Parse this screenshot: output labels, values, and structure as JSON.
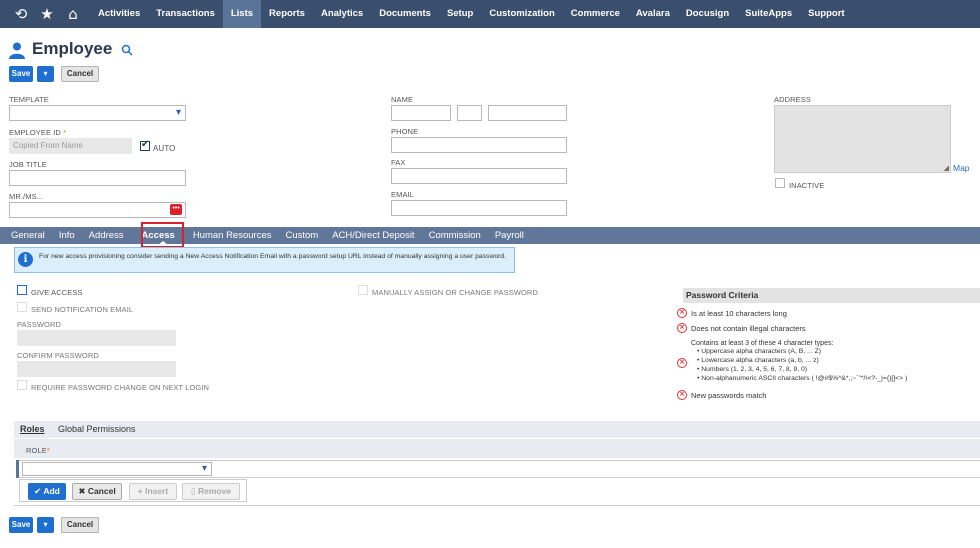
{
  "nav": {
    "items": [
      "Activities",
      "Transactions",
      "Lists",
      "Reports",
      "Analytics",
      "Documents",
      "Setup",
      "Customization",
      "Commerce",
      "Avalara",
      "Docusign",
      "SuiteApps",
      "Support"
    ],
    "active": "Lists"
  },
  "header": {
    "title": "Employee"
  },
  "buttons": {
    "save": "Save",
    "cancel": "Cancel"
  },
  "form": {
    "template_label": "TEMPLATE",
    "employee_id_label": "EMPLOYEE ID",
    "required_mark": "*",
    "employee_id_placeholder": "Copied From Name",
    "auto_label": "AUTO",
    "job_title_label": "JOB TITLE",
    "mr_ms_label": "MR./MS...",
    "name_label": "NAME",
    "phone_label": "PHONE",
    "fax_label": "FAX",
    "email_label": "EMAIL",
    "address_label": "ADDRESS",
    "map_link": "Map",
    "inactive_label": "INACTIVE"
  },
  "subtabs": [
    "General",
    "Info",
    "Address",
    "Access",
    "Human Resources",
    "Custom",
    "ACH/Direct Deposit",
    "Commission",
    "Payroll"
  ],
  "active_subtab": "Access",
  "access": {
    "info_text": "For new access provisioning consider sending a New Access Notification Email with a password setup URL instead of manually assigning a user password.",
    "give_access": "GIVE ACCESS",
    "send_notification": "SEND NOTIFICATION EMAIL",
    "password_label": "PASSWORD",
    "confirm_password_label": "CONFIRM PASSWORD",
    "require_change": "REQUIRE PASSWORD CHANGE ON NEXT LOGIN",
    "manually_assign": "MANUALLY ASSIGN OR CHANGE PASSWORD"
  },
  "password_criteria": {
    "title": "Password Criteria",
    "rule1": "Is at least 10 characters long",
    "rule2": "Does not contain illegal characters",
    "rule3_intro": "Contains at least 3 of these 4 character types:",
    "rule3_items": [
      "• Uppercase alpha characters (A, B, ... Z)",
      "• Lowercase alpha characters (a, b, ... z)",
      "• Numbers (1, 2, 3, 4, 5, 6, 7, 8, 9, 0)",
      "• Non-alphanumeric ASCII characters ( !@#$%^&*,;~`\"*/\\<?-_|={}[]<> )"
    ],
    "rule4": "New passwords match"
  },
  "roles": {
    "tabs": [
      "Roles",
      "Global Permissions"
    ],
    "role_label": "ROLE",
    "add": "Add",
    "cancel": "Cancel",
    "insert": "Insert",
    "remove": "Remove"
  },
  "colors": {
    "nav_bg": "#3a4f6e",
    "subtab_bg": "#607799",
    "primary": "#1f6fd1",
    "highlight": "#d9212c"
  }
}
